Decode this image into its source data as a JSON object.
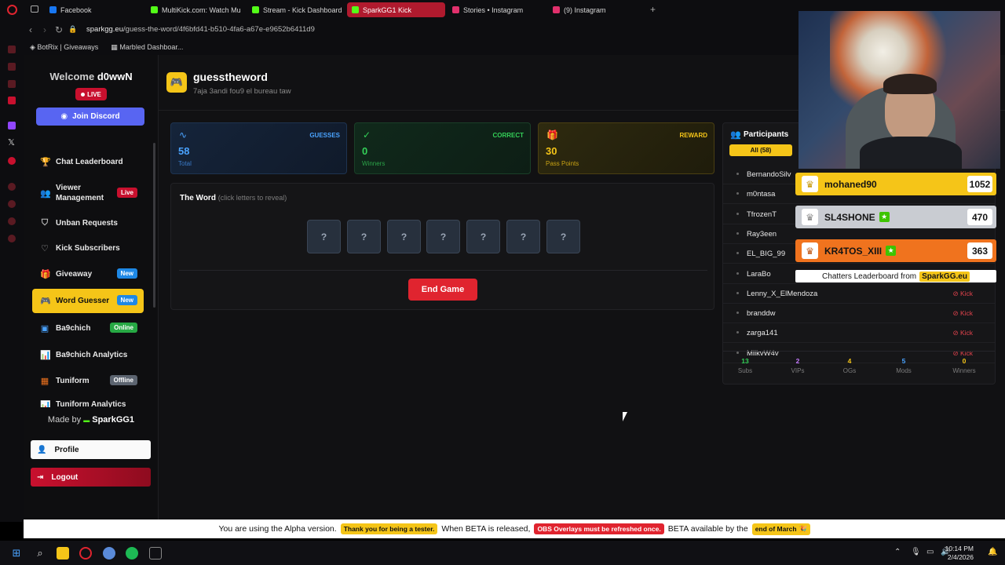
{
  "browser": {
    "tabs": [
      {
        "label": "Facebook",
        "color": "#1877f2"
      },
      {
        "label": "MultiKick.com: Watch Mu",
        "color": "#53fc18"
      },
      {
        "label": "Stream - Kick Dashboard",
        "color": "#53fc18"
      },
      {
        "label": "SparkGG1 Kick",
        "color": "#53fc18"
      },
      {
        "label": "Stories • Instagram",
        "color": "#e1306c"
      },
      {
        "label": "(9) Instagram",
        "color": "#e1306c"
      }
    ],
    "new_tab_label": "+",
    "url_host": "sparkgg.eu",
    "url_path": "/guess-the-word/4f6bfd41-b510-4fa6-a67e-e9652b6411d9",
    "bookmarks": [
      "BotRix | Giveaways",
      "Marbled Dashboar..."
    ]
  },
  "sidebar": {
    "welcome_prefix": "Welcome",
    "username": "d0wwN",
    "live_label": "LIVE",
    "join_discord": "Join Discord",
    "items": [
      {
        "label": "Chat Leaderboard",
        "icon": "trophy-icon",
        "glyph": "🏆",
        "badge": ""
      },
      {
        "label": "Viewer Management",
        "icon": "users-icon",
        "glyph": "👥",
        "badge": "Live"
      },
      {
        "label": "Unban Requests",
        "icon": "shield-icon",
        "glyph": "⛉",
        "badge": ""
      },
      {
        "label": "Kick Subscribers",
        "icon": "heart-icon",
        "glyph": "♡",
        "badge": ""
      },
      {
        "label": "Giveaway",
        "icon": "gift-icon",
        "glyph": "🎁",
        "badge": "New"
      },
      {
        "label": "Word Guesser",
        "icon": "gamepad-icon",
        "glyph": "🎮",
        "badge": "New"
      },
      {
        "label": "Ba9chich",
        "icon": "ba9chich-icon",
        "glyph": "▣",
        "badge": "Online"
      },
      {
        "label": "Ba9chich Analytics",
        "icon": "chart-icon",
        "glyph": "📊",
        "badge": ""
      },
      {
        "label": "Tuniform",
        "icon": "tuniform-icon",
        "glyph": "▦",
        "badge": "Offline"
      },
      {
        "label": "Tuniform Analytics",
        "icon": "chart-icon",
        "glyph": "📊",
        "badge": ""
      }
    ],
    "made_by_prefix": "Made by",
    "made_by_name": "SparkGG1",
    "profile": "Profile",
    "logout": "Logout"
  },
  "game": {
    "title": "guesstheword",
    "subtitle": "7aja 3andi fou9 el bureau taw",
    "stats": [
      {
        "label": "GUESSES",
        "value": "58",
        "sub": "Total",
        "icon": "activity-icon",
        "glyph": "∿",
        "color": "#4aa3ff"
      },
      {
        "label": "CORRECT",
        "value": "0",
        "sub": "Winners",
        "icon": "check-circle-icon",
        "glyph": "✓",
        "color": "#34d058"
      },
      {
        "label": "REWARD",
        "value": "30",
        "sub": "Pass Points",
        "icon": "gift-icon",
        "glyph": "🎁",
        "color": "#f5c518"
      }
    ],
    "word_title": "The Word",
    "word_hint": "(click letters to reveal)",
    "letters": [
      "?",
      "?",
      "?",
      "?",
      "?",
      "?",
      "?"
    ],
    "end_game": "End Game"
  },
  "participants": {
    "title": "Participants",
    "filter_all": "All (58)",
    "kick_label": "Kick",
    "rows": [
      "BernandoSilv",
      "m0ntasa",
      "TfrozenT",
      "Ray3een",
      "EL_BIG_99",
      "LaraBo",
      "Lenny_X_ElMendoza",
      "branddw",
      "zarga141",
      "MilkvW4v"
    ],
    "stats": [
      {
        "value": "13",
        "label": "Subs",
        "color": "#34d058"
      },
      {
        "value": "2",
        "label": "VIPs",
        "color": "#c77dff"
      },
      {
        "value": "4",
        "label": "OGs",
        "color": "#f5c518"
      },
      {
        "value": "5",
        "label": "Mods",
        "color": "#4aa3ff"
      },
      {
        "value": "0",
        "label": "Winners",
        "color": "#f5c518"
      }
    ]
  },
  "leaderboard_overlay": {
    "rows": [
      {
        "name": "mohaned90",
        "score": "1052",
        "star": false,
        "bg": "#f5c518"
      },
      {
        "name": "SL4SHONE",
        "score": "470",
        "star": true,
        "bg": "#c9ccd2"
      },
      {
        "name": "KR4TOS_XIII",
        "score": "363",
        "star": true,
        "bg": "#f0731e"
      }
    ],
    "footer_text": "Chatters Leaderboard from",
    "footer_brand": "SparkGG.eu"
  },
  "banner": {
    "part1": "You are using the Alpha version.",
    "hl1": "Thank you for being a tester.",
    "part2": "When BETA is released,",
    "hl2": "OBS Overlays must be refreshed once.",
    "part3": "BETA available by the",
    "hl3": "end of March 🎉"
  },
  "taskbar": {
    "time": "10:14 PM",
    "date": "2/4/2026"
  }
}
